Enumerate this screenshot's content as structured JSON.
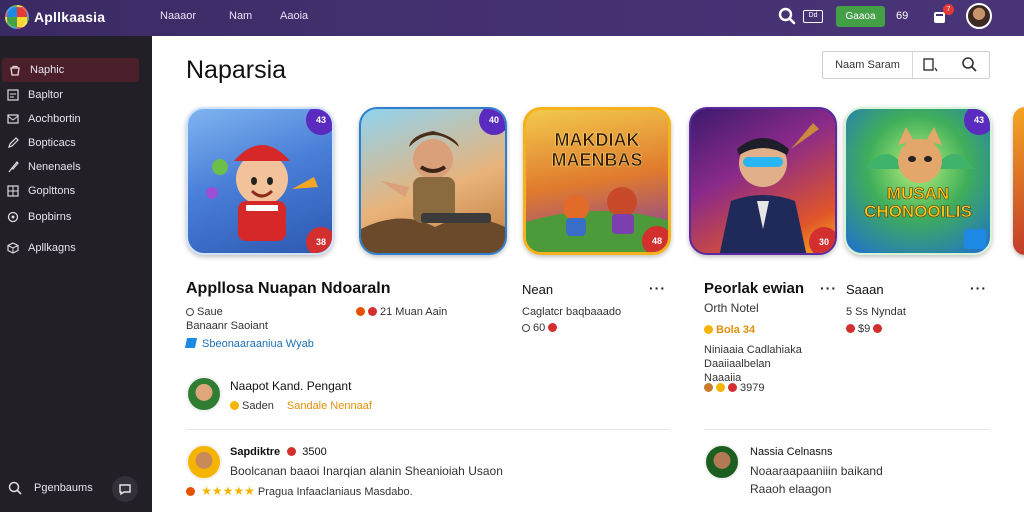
{
  "app": {
    "brand": "Apllkaasia",
    "nav": [
      "Naaaor",
      "Nam",
      "Aaoia"
    ],
    "tag_label": "Dd",
    "green_button": "Gaaoa",
    "count": "69",
    "bell_badge": "7"
  },
  "sidebar": {
    "items": [
      {
        "label": "Naphic",
        "icon": "bag-icon"
      },
      {
        "label": "Bapltor",
        "icon": "doc-icon"
      },
      {
        "label": "Aochbortin",
        "icon": "mail-icon"
      },
      {
        "label": "Bopticacs",
        "icon": "pen-icon"
      },
      {
        "label": "Nenenaels",
        "icon": "brush-icon"
      },
      {
        "label": "Goplttons",
        "icon": "grid-icon"
      },
      {
        "label": "Bopbirns",
        "icon": "gear-icon"
      },
      {
        "label": "Apllkagns",
        "icon": "cube-icon"
      }
    ],
    "bottom_label": "Pgenbaums"
  },
  "main": {
    "title": "Naparsia",
    "search_text": "Naam Saram",
    "cards": [
      {
        "badge_top": "43",
        "badge_bottom": "38"
      },
      {
        "badge_top": "40"
      },
      {
        "art_title": "MAKDIAK MAENBAS",
        "badge_bottom": "48"
      },
      {
        "badge_bottom": "30"
      },
      {
        "art_title": "MUSAN CHONOOILIS",
        "badge_top": "43"
      }
    ],
    "app1": {
      "title": "Appllosa Nuapan Ndoaraln",
      "line1": "Saue",
      "line2": "Banaanr Saoiant",
      "link": "Sbeonaaraaniua Wyab",
      "rating": "21 Muan Aain"
    },
    "app3": {
      "name": "Nean",
      "line1": "Caglatcr baqbaaado",
      "line2": "60"
    },
    "app4": {
      "title": "Peorlak ewian",
      "subtitle": "Orth Notel",
      "price": "Bola 34",
      "desc1": "Niniaaia Cadlahiaka",
      "desc2": "Daaiiaalbelan",
      "desc3": "Naaaiia",
      "footer": "3979"
    },
    "app5": {
      "name": "Saaan",
      "line1": "5 Ss Nyndat",
      "line2": "$9"
    },
    "review1": {
      "name": "Naapot Kand. Pengant",
      "tag": "Saden",
      "highlight": "Sandale Nennaaf"
    },
    "review2": {
      "name": "Sapdiktre",
      "score": "3500",
      "text": "Boolcanan baaoi Inarqian alanin Sheanioiah Usaon",
      "footer": "Pragua Infaaclaniaus Masdabo."
    },
    "review3": {
      "name": "Nassia Celnasns",
      "line1": "Noaaraapaaniiin baikand",
      "line2": "Raaoh elaagon"
    }
  },
  "colors": {
    "topbar": "#43306f",
    "sidebar": "#221f26",
    "accent_green": "#43a047",
    "active_item": "#4a1f2a",
    "badge_red": "#d32f2f",
    "badge_purple": "#5b2bc0"
  }
}
